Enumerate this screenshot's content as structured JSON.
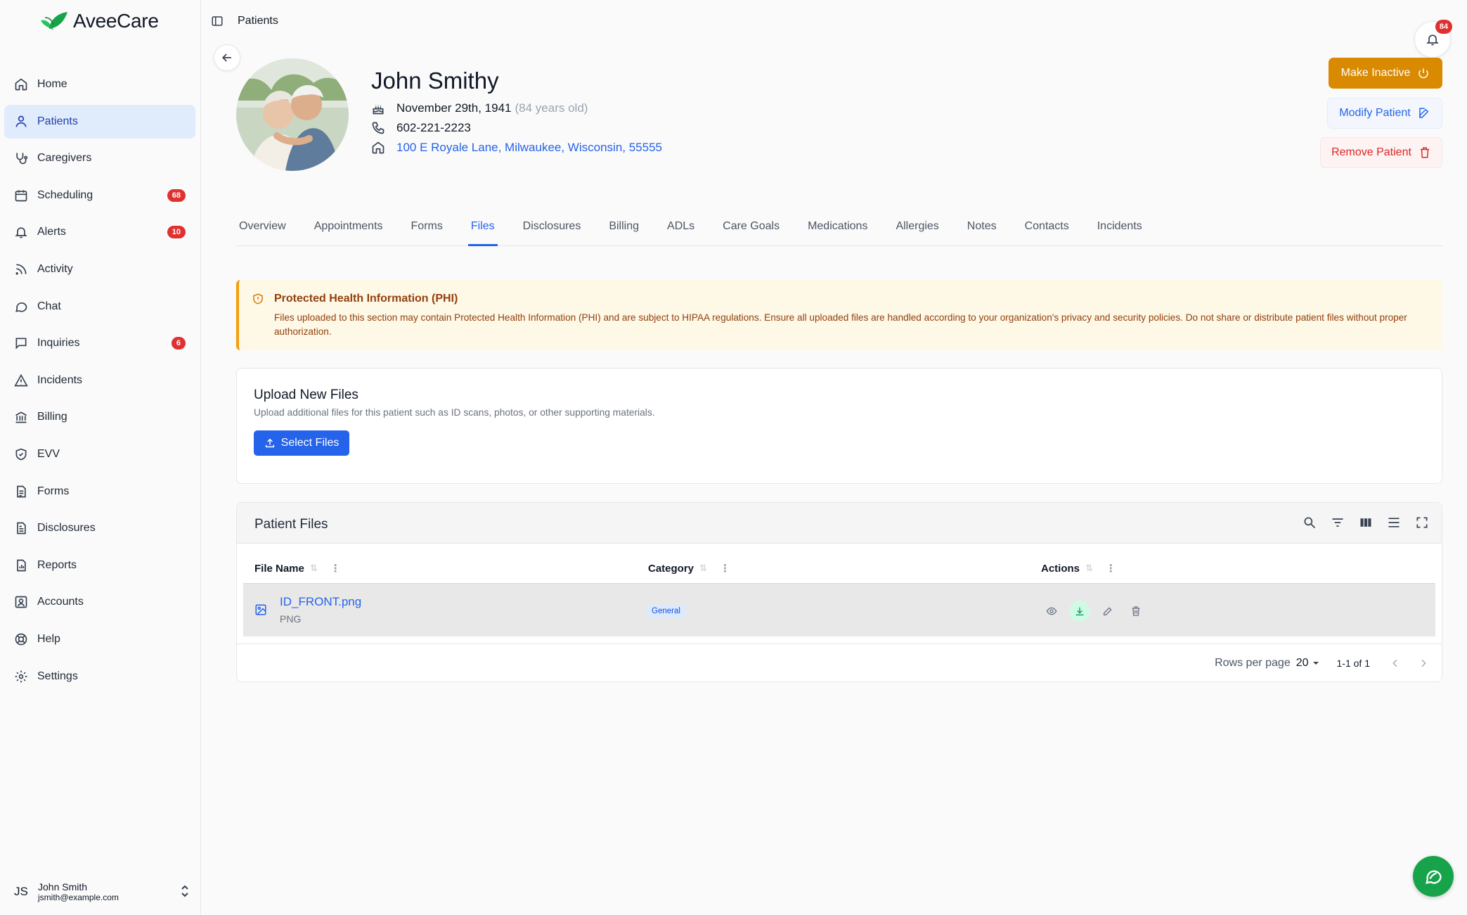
{
  "app": {
    "name": "AveeCare"
  },
  "sidebar": {
    "items": [
      {
        "label": "Home",
        "icon": "home-icon"
      },
      {
        "label": "Patients",
        "icon": "user-icon",
        "active": true
      },
      {
        "label": "Caregivers",
        "icon": "stethoscope-icon"
      },
      {
        "label": "Scheduling",
        "icon": "calendar-icon",
        "badge": "68"
      },
      {
        "label": "Alerts",
        "icon": "bell-icon",
        "badge": "10"
      },
      {
        "label": "Activity",
        "icon": "rss-icon"
      },
      {
        "label": "Chat",
        "icon": "chat-icon"
      },
      {
        "label": "Inquiries",
        "icon": "message-square-icon",
        "badge": "6"
      },
      {
        "label": "Incidents",
        "icon": "warning-triangle-icon"
      },
      {
        "label": "Billing",
        "icon": "bank-icon"
      },
      {
        "label": "EVV",
        "icon": "shield-check-icon"
      },
      {
        "label": "Forms",
        "icon": "form-icon"
      },
      {
        "label": "Disclosures",
        "icon": "document-icon"
      },
      {
        "label": "Reports",
        "icon": "report-icon"
      },
      {
        "label": "Accounts",
        "icon": "account-icon"
      },
      {
        "label": "Help",
        "icon": "lifebuoy-icon"
      },
      {
        "label": "Settings",
        "icon": "gear-icon"
      }
    ]
  },
  "user": {
    "initials": "JS",
    "name": "John Smith",
    "email": "jsmith@example.com"
  },
  "breadcrumb": {
    "current": "Patients"
  },
  "notifications": {
    "count": "84"
  },
  "patient": {
    "name": "John Smithy",
    "dob": "November 29th, 1941",
    "age": "(84 years old)",
    "phone": "602-221-2223",
    "address": "100 E Royale Lane, Milwaukee, Wisconsin, 55555"
  },
  "actions": {
    "make_inactive": "Make Inactive",
    "modify": "Modify Patient",
    "remove": "Remove Patient"
  },
  "tabs": [
    "Overview",
    "Appointments",
    "Forms",
    "Files",
    "Disclosures",
    "Billing",
    "ADLs",
    "Care Goals",
    "Medications",
    "Allergies",
    "Notes",
    "Contacts",
    "Incidents"
  ],
  "active_tab": "Files",
  "phi_notice": {
    "title": "Protected Health Information (PHI)",
    "text": "Files uploaded to this section may contain Protected Health Information (PHI) and are subject to HIPAA regulations. Ensure all uploaded files are handled according to your organization's privacy and security policies. Do not share or distribute patient files without proper authorization."
  },
  "upload": {
    "title": "Upload New Files",
    "description": "Upload additional files for this patient such as ID scans, photos, or other supporting materials.",
    "button": "Select Files"
  },
  "files_table": {
    "title": "Patient Files",
    "columns": [
      "File Name",
      "Category",
      "Actions"
    ],
    "rows": [
      {
        "name": "ID_FRONT.png",
        "type": "PNG",
        "category": "General"
      }
    ],
    "rows_per_page_label": "Rows per page",
    "rows_per_page": "20",
    "range": "1-1 of 1"
  },
  "colors": {
    "primary": "#2563eb",
    "warning": "#d98a00",
    "danger": "#dc2626",
    "badge": "#e03131",
    "chat_fab": "#16a34a"
  }
}
